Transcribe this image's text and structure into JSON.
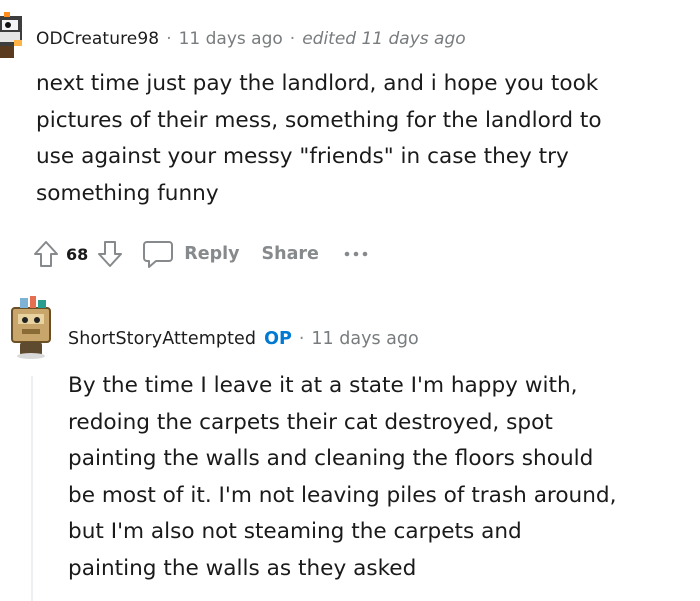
{
  "comment1": {
    "username": "ODCreature98",
    "separator": "·",
    "timestamp": "11 days ago",
    "edited": "edited 11 days ago",
    "body_lines": [
      "next time just pay the landlord, and i hope you took",
      "pictures of their mess, something for the landlord to",
      "use against your messy \"friends\" in case they try",
      "something funny"
    ],
    "actions": {
      "upvote_icon": "upvote-arrow-icon",
      "score": "68",
      "downvote_icon": "downvote-arrow-icon",
      "reply_icon": "comment-bubble-icon",
      "reply_label": "Reply",
      "share_label": "Share",
      "more_icon": "more-dots-icon"
    }
  },
  "comment2": {
    "username": "ShortStoryAttempted",
    "op_badge": "OP",
    "separator": "·",
    "timestamp": "11 days ago",
    "body_lines": [
      "By the time I leave it at a state I'm happy with,",
      "redoing the carpets their cat destroyed, spot",
      "painting the walls and cleaning the floors should",
      "be most of it. I'm not leaving piles of trash around,",
      "but I'm also not steaming the carpets and",
      "painting the walls as they asked"
    ]
  },
  "colors": {
    "text": "#1a1a1b",
    "meta": "#787c7e",
    "action": "#878a8c",
    "op": "#0079d3",
    "thread_line": "#edeff1"
  }
}
